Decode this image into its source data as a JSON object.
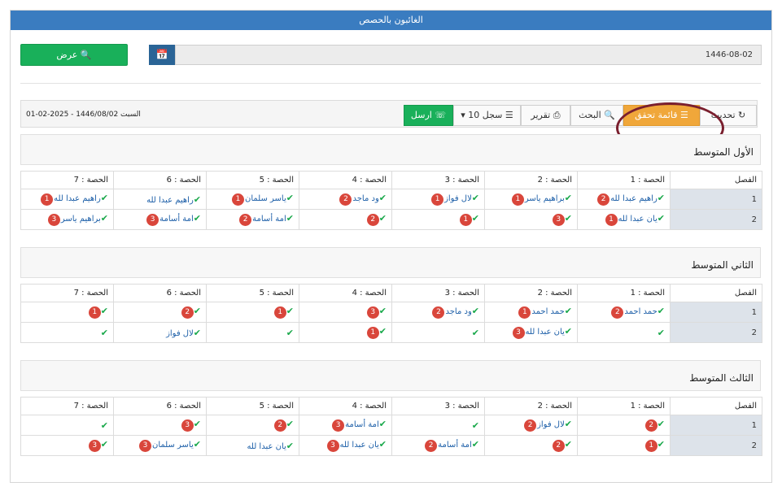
{
  "header": {
    "title": "الغائبون بالحصص"
  },
  "filter": {
    "show_label": "عرض",
    "date_value": "1446-08-02"
  },
  "toolbar": {
    "date_text": "السبت 1446/08/02 - 2025-02-01",
    "send_label": "ارسل",
    "records_label": "10 سجل",
    "report_label": "تقرير",
    "search_label": "البحث",
    "checklist_label": "قائمة تحقق",
    "refresh_label": "تحديث"
  },
  "columns": [
    "الفصل",
    "الحصة : 1",
    "الحصة : 2",
    "الحصة : 3",
    "الحصة : 4",
    "الحصة : 5",
    "الحصة : 6",
    "الحصة : 7"
  ],
  "sections": [
    {
      "title": "الأول المتوسط",
      "rows": [
        {
          "class": "1",
          "cells": [
            {
              "name": "راهيم عبدا لله",
              "badge": "2"
            },
            {
              "name": "براهيم ياسر",
              "badge": "1"
            },
            {
              "name": "لال فواز",
              "badge": "1"
            },
            {
              "name": "ود ماجد",
              "badge": "2"
            },
            {
              "name": "ياسر سلمان",
              "badge": "1"
            },
            {
              "name": "راهيم عبدا لله",
              "badge": ""
            },
            {
              "name": "راهيم عبدا لله",
              "badge": "1"
            }
          ]
        },
        {
          "class": "2",
          "cells": [
            {
              "name": "يان عبدا لله",
              "badge": "1"
            },
            {
              "name": "",
              "badge": "3"
            },
            {
              "name": "",
              "badge": "1"
            },
            {
              "name": "",
              "badge": "2"
            },
            {
              "name": "امة أسامة",
              "badge": "2"
            },
            {
              "name": "امة أسامة",
              "badge": "3"
            },
            {
              "name": "براهيم ياسر",
              "badge": "3"
            }
          ]
        }
      ]
    },
    {
      "title": "الثاني المتوسط",
      "rows": [
        {
          "class": "1",
          "cells": [
            {
              "name": "حمد احمد",
              "badge": "2"
            },
            {
              "name": "حمد احمد",
              "badge": "1"
            },
            {
              "name": "ود ماجد",
              "badge": "2"
            },
            {
              "name": "",
              "badge": "3"
            },
            {
              "name": "",
              "badge": "1"
            },
            {
              "name": "",
              "badge": "2"
            },
            {
              "name": "",
              "badge": "1"
            }
          ]
        },
        {
          "class": "2",
          "cells": [
            {
              "name": "",
              "badge": ""
            },
            {
              "name": "يان عبدا لله",
              "badge": "3"
            },
            {
              "name": "",
              "badge": ""
            },
            {
              "name": "",
              "badge": "1"
            },
            {
              "name": "",
              "badge": ""
            },
            {
              "name": "لال فواز",
              "badge": ""
            },
            {
              "name": "",
              "badge": ""
            }
          ]
        }
      ]
    },
    {
      "title": "الثالث المتوسط",
      "rows": [
        {
          "class": "1",
          "cells": [
            {
              "name": "",
              "badge": "2"
            },
            {
              "name": "لال فواز",
              "badge": "2"
            },
            {
              "name": "",
              "badge": ""
            },
            {
              "name": "امة أسامة",
              "badge": "3"
            },
            {
              "name": "",
              "badge": "2"
            },
            {
              "name": "",
              "badge": "3"
            },
            {
              "name": "",
              "badge": ""
            }
          ]
        },
        {
          "class": "2",
          "cells": [
            {
              "name": "",
              "badge": "1"
            },
            {
              "name": "",
              "badge": "2"
            },
            {
              "name": "امة أسامة",
              "badge": "2"
            },
            {
              "name": "يان عبدا لله",
              "badge": "3"
            },
            {
              "name": "يان عبدا لله",
              "badge": ""
            },
            {
              "name": "ياسر سلمان",
              "badge": "3"
            },
            {
              "name": "",
              "badge": "3"
            }
          ]
        }
      ]
    }
  ],
  "colors": {
    "header": "#3a7cc0",
    "green": "#19b05a",
    "orange": "#f0a73a",
    "badge": "#d9463b",
    "annotation": "#7a1f2e"
  },
  "icons": [
    "search-icon",
    "calendar-icon",
    "whatsapp-icon",
    "list-icon",
    "print-icon",
    "checklist-icon",
    "refresh-icon",
    "check-icon"
  ]
}
